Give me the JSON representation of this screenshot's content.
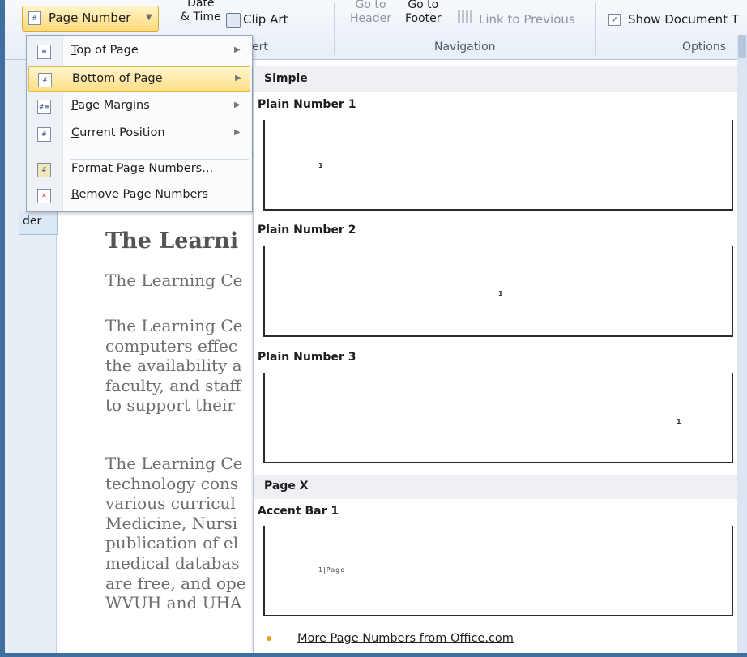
{
  "ribbon": {
    "page_number_label": "Page Number",
    "date_time_line1": "Date",
    "date_time_line2": "& Time",
    "clip_art_label": "Clip Art",
    "insert_group_fragment": "ert",
    "go_to_header_line1": "Go to",
    "go_to_header_line2": "Header",
    "go_to_footer_line1": "Go to",
    "go_to_footer_line2": "Footer",
    "link_to_previous_label": "Link to Previous",
    "navigation_group_label": "Navigation",
    "show_document_text_label": "Show Document T",
    "options_group_label": "Options"
  },
  "menu": {
    "items": [
      {
        "label": "Top of Page",
        "key": "T",
        "rest": "op of Page"
      },
      {
        "label": "Bottom of Page",
        "key": "B",
        "rest": "ottom of Page"
      },
      {
        "label": "Page Margins",
        "key": "P",
        "rest": "age Margins"
      },
      {
        "label": "Current Position",
        "key": "C",
        "rest": "urrent Position"
      },
      {
        "label": "Format Page Numbers...",
        "key": "F",
        "rest": "ormat Page Numbers..."
      },
      {
        "label": "Remove Page Numbers",
        "key": "R",
        "rest": "emove Page Numbers"
      }
    ]
  },
  "document": {
    "header_tab": "der",
    "title": "The Learni",
    "lines_block1": [
      "The Learning Ce"
    ],
    "lines_block2": [
      "The Learning Ce",
      "computers effec",
      "the availability a",
      "faculty, and staff",
      "to support their"
    ],
    "lines_block3": [
      "The Learning Ce",
      "technology cons",
      "various curricul",
      "Medicine, Nursi",
      "publication of el",
      "medical databas",
      "are free, and ope",
      "WVUH and UHA"
    ]
  },
  "gallery": {
    "section_simple": "Simple",
    "plain_number_1": "Plain Number 1",
    "plain_number_2": "Plain Number 2",
    "plain_number_3": "Plain Number 3",
    "section_page_x": "Page X",
    "accent_bar_1": "Accent Bar 1",
    "thumb_mark": "1",
    "accent_text": "1|Page",
    "more_link": "More Page Numbers from Office.com"
  }
}
